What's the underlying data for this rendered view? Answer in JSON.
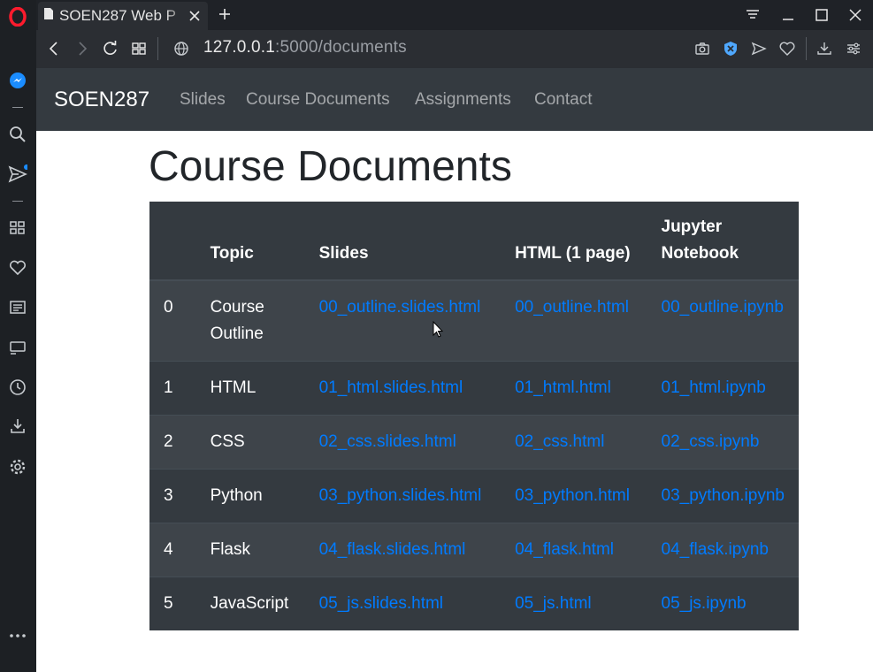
{
  "browser": {
    "tab_title": "SOEN287 Web P",
    "url_host": "127.0.0.1",
    "url_rest": ":5000/documents"
  },
  "navbar": {
    "brand": "SOEN287",
    "links": [
      "Slides",
      "Course Documents",
      "Assignments",
      "Contact"
    ]
  },
  "page": {
    "heading": "Course Documents"
  },
  "table": {
    "headers": [
      "",
      "Topic",
      "Slides",
      "HTML (1 page)",
      "Jupyter Notebook"
    ],
    "rows": [
      [
        "0",
        "Course Outline",
        "00_outline.slides.html",
        "00_outline.html",
        "00_outline.ipynb"
      ],
      [
        "1",
        "HTML",
        "01_html.slides.html",
        "01_html.html",
        "01_html.ipynb"
      ],
      [
        "2",
        "CSS",
        "02_css.slides.html",
        "02_css.html",
        "02_css.ipynb"
      ],
      [
        "3",
        "Python",
        "03_python.slides.html",
        "03_python.html",
        "03_python.ipynb"
      ],
      [
        "4",
        "Flask",
        "04_flask.slides.html",
        "04_flask.html",
        "04_flask.ipynb"
      ],
      [
        "5",
        "JavaScript",
        "05_js.slides.html",
        "05_js.html",
        "05_js.ipynb"
      ]
    ]
  },
  "colors": {
    "navbar_bg": "#343a40",
    "link": "#007bff",
    "row_odd": "#3e444a",
    "row_even": "#343a40",
    "browser_accent": "#ff1b2d"
  },
  "icons": {
    "sidebar": [
      "opera-logo-icon",
      "messenger-icon",
      "search-icon",
      "send-icon",
      "speed-dial-icon",
      "heart-icon",
      "news-icon",
      "player-icon",
      "history-icon",
      "download-icon",
      "settings-icon",
      "more-icon"
    ]
  }
}
